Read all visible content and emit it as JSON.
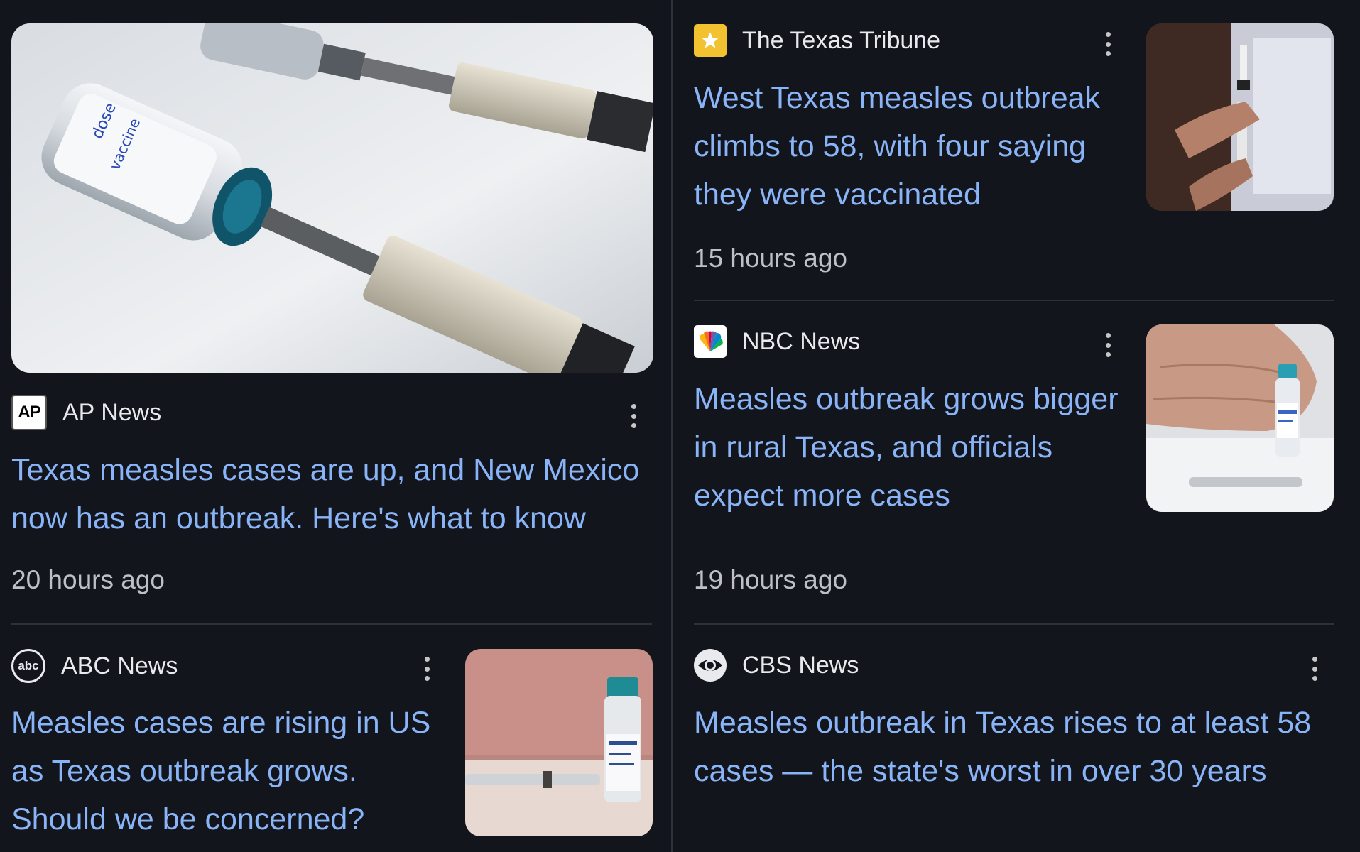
{
  "articles": [
    {
      "source": "AP News",
      "source_icon": "ap-news-logo-icon",
      "headline": "Texas measles cases are up, and New Mexico now has an outbreak. Here's what to know",
      "time": "20 hours ago",
      "image": "vaccine-vials-and-syringes-image"
    },
    {
      "source": "The Texas Tribune",
      "source_icon": "texas-tribune-star-icon",
      "headline": "West Texas measles outbreak climbs to 58, with four saying they were vaccinated",
      "time": "15 hours ago",
      "image": "hands-filling-syringe-image"
    },
    {
      "source": "NBC News",
      "source_icon": "nbc-peacock-icon",
      "headline": "Measles outbreak grows bigger in rural Texas, and officials expect more cases",
      "time": "19 hours ago",
      "image": "hand-holding-vaccine-vial-image"
    },
    {
      "source": "ABC News",
      "source_icon": "abc-news-logo-icon",
      "headline": "Measles cases are rising in US as Texas outbreak grows. Should we be concerned?",
      "image": "vaccine-vial-and-syringe-image"
    },
    {
      "source": "CBS News",
      "source_icon": "cbs-eye-icon",
      "headline": "Measles outbreak in Texas rises to at least 58 cases — the state's worst in over 30 years"
    }
  ],
  "colors": {
    "background": "#13151c",
    "headline": "#8ab4f8",
    "divider": "#2e3139",
    "timestamp": "#bdc1c6"
  }
}
